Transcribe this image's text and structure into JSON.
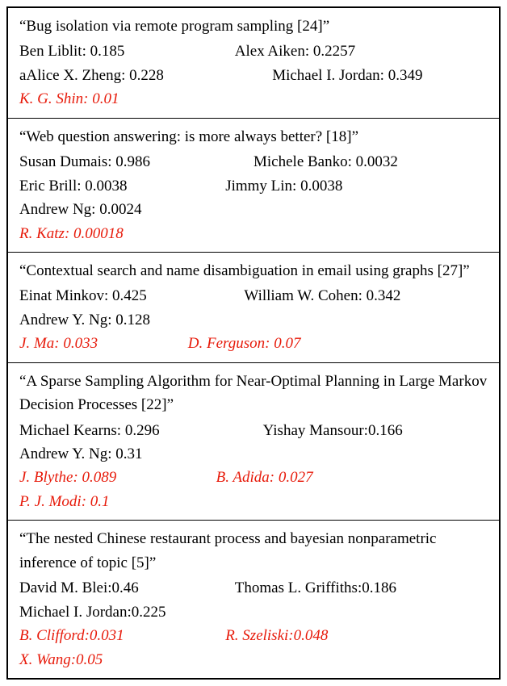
{
  "entries": [
    {
      "title": "“Bug isolation via remote program sampling [24]”",
      "authors": [
        [
          {
            "text": "Ben Liblit: 0.185"
          },
          {
            "text": "Alex Aiken: 0.2257"
          }
        ],
        [
          {
            "text": "aAlice X. Zheng: 0.228"
          },
          {
            "text": "Michael I. Jordan: 0.349"
          }
        ]
      ],
      "red": [
        [
          {
            "text": "K. G. Shin: 0.01"
          }
        ]
      ]
    },
    {
      "title": "“Web question answering: is more always better? [18]”",
      "authors": [
        [
          {
            "text": "Susan Dumais: 0.986"
          },
          {
            "text": "Michele Banko: 0.0032"
          }
        ],
        [
          {
            "text": "Eric Brill: 0.0038"
          },
          {
            "text": "Jimmy Lin: 0.0038"
          }
        ],
        [
          {
            "text": "Andrew Ng: 0.0024"
          }
        ]
      ],
      "red": [
        [
          {
            "text": "R. Katz: 0.00018"
          }
        ]
      ]
    },
    {
      "title": "“Contextual search and name disambiguation in email using graphs [27]”",
      "authors": [
        [
          {
            "text": "Einat Minkov: 0.425"
          },
          {
            "text": "William W. Cohen: 0.342"
          }
        ],
        [
          {
            "text": "Andrew Y. Ng: 0.128"
          }
        ]
      ],
      "red": [
        [
          {
            "text": "J. Ma: 0.033"
          },
          {
            "text": "D. Ferguson: 0.07"
          }
        ]
      ]
    },
    {
      "title": "“A Sparse Sampling Algorithm for Near-Optimal Planning in Large Markov Decision Processes [22]”",
      "authors": [
        [
          {
            "text": "Michael Kearns: 0.296"
          },
          {
            "text": "Yishay Mansour:0.166"
          }
        ],
        [
          {
            "text": "Andrew Y. Ng: 0.31"
          }
        ]
      ],
      "red": [
        [
          {
            "text": "J. Blythe: 0.089"
          },
          {
            "text": "B. Adida: 0.027"
          }
        ],
        [
          {
            "text": "P. J. Modi: 0.1"
          }
        ]
      ]
    },
    {
      "title": "“The nested Chinese restaurant process and bayesian nonparametric inference of topic [5]”",
      "authors": [
        [
          {
            "text": "David M. Blei:0.46"
          },
          {
            "text": "Thomas L. Griffiths:0.186"
          }
        ],
        [
          {
            "text": "Michael I. Jordan:0.225"
          }
        ]
      ],
      "red": [
        [
          {
            "text": "B. Clifford:0.031"
          },
          {
            "text": "R. Szeliski:0.048"
          }
        ],
        [
          {
            "text": "X. Wang:0.05"
          }
        ]
      ]
    }
  ],
  "chart_data": {
    "type": "table",
    "title": "Author score table per paper",
    "columns": [
      "paper_title",
      "author",
      "score",
      "highlighted_red"
    ],
    "rows": [
      {
        "paper_title": "Bug isolation via remote program sampling [24]",
        "author": "Ben Liblit",
        "score": 0.185,
        "highlighted_red": false
      },
      {
        "paper_title": "Bug isolation via remote program sampling [24]",
        "author": "Alex Aiken",
        "score": 0.2257,
        "highlighted_red": false
      },
      {
        "paper_title": "Bug isolation via remote program sampling [24]",
        "author": "aAlice X. Zheng",
        "score": 0.228,
        "highlighted_red": false
      },
      {
        "paper_title": "Bug isolation via remote program sampling [24]",
        "author": "Michael I. Jordan",
        "score": 0.349,
        "highlighted_red": false
      },
      {
        "paper_title": "Bug isolation via remote program sampling [24]",
        "author": "K. G. Shin",
        "score": 0.01,
        "highlighted_red": true
      },
      {
        "paper_title": "Web question answering: is more always better? [18]",
        "author": "Susan Dumais",
        "score": 0.986,
        "highlighted_red": false
      },
      {
        "paper_title": "Web question answering: is more always better? [18]",
        "author": "Michele Banko",
        "score": 0.0032,
        "highlighted_red": false
      },
      {
        "paper_title": "Web question answering: is more always better? [18]",
        "author": "Eric Brill",
        "score": 0.0038,
        "highlighted_red": false
      },
      {
        "paper_title": "Web question answering: is more always better? [18]",
        "author": "Jimmy Lin",
        "score": 0.0038,
        "highlighted_red": false
      },
      {
        "paper_title": "Web question answering: is more always better? [18]",
        "author": "Andrew Ng",
        "score": 0.0024,
        "highlighted_red": false
      },
      {
        "paper_title": "Web question answering: is more always better? [18]",
        "author": "R. Katz",
        "score": 0.00018,
        "highlighted_red": true
      },
      {
        "paper_title": "Contextual search and name disambiguation in email using graphs [27]",
        "author": "Einat Minkov",
        "score": 0.425,
        "highlighted_red": false
      },
      {
        "paper_title": "Contextual search and name disambiguation in email using graphs [27]",
        "author": "William W. Cohen",
        "score": 0.342,
        "highlighted_red": false
      },
      {
        "paper_title": "Contextual search and name disambiguation in email using graphs [27]",
        "author": "Andrew Y. Ng",
        "score": 0.128,
        "highlighted_red": false
      },
      {
        "paper_title": "Contextual search and name disambiguation in email using graphs [27]",
        "author": "J. Ma",
        "score": 0.033,
        "highlighted_red": true
      },
      {
        "paper_title": "Contextual search and name disambiguation in email using graphs [27]",
        "author": "D. Ferguson",
        "score": 0.07,
        "highlighted_red": true
      },
      {
        "paper_title": "A Sparse Sampling Algorithm for Near-Optimal Planning in Large Markov Decision Processes [22]",
        "author": "Michael Kearns",
        "score": 0.296,
        "highlighted_red": false
      },
      {
        "paper_title": "A Sparse Sampling Algorithm for Near-Optimal Planning in Large Markov Decision Processes [22]",
        "author": "Yishay Mansour",
        "score": 0.166,
        "highlighted_red": false
      },
      {
        "paper_title": "A Sparse Sampling Algorithm for Near-Optimal Planning in Large Markov Decision Processes [22]",
        "author": "Andrew Y. Ng",
        "score": 0.31,
        "highlighted_red": false
      },
      {
        "paper_title": "A Sparse Sampling Algorithm for Near-Optimal Planning in Large Markov Decision Processes [22]",
        "author": "J. Blythe",
        "score": 0.089,
        "highlighted_red": true
      },
      {
        "paper_title": "A Sparse Sampling Algorithm for Near-Optimal Planning in Large Markov Decision Processes [22]",
        "author": "B. Adida",
        "score": 0.027,
        "highlighted_red": true
      },
      {
        "paper_title": "A Sparse Sampling Algorithm for Near-Optimal Planning in Large Markov Decision Processes [22]",
        "author": "P. J. Modi",
        "score": 0.1,
        "highlighted_red": true
      },
      {
        "paper_title": "The nested Chinese restaurant process and bayesian nonparametric inference of topic [5]",
        "author": "David M. Blei",
        "score": 0.46,
        "highlighted_red": false
      },
      {
        "paper_title": "The nested Chinese restaurant process and bayesian nonparametric inference of topic [5]",
        "author": "Thomas L. Griffiths",
        "score": 0.186,
        "highlighted_red": false
      },
      {
        "paper_title": "The nested Chinese restaurant process and bayesian nonparametric inference of topic [5]",
        "author": "Michael I. Jordan",
        "score": 0.225,
        "highlighted_red": false
      },
      {
        "paper_title": "The nested Chinese restaurant process and bayesian nonparametric inference of topic [5]",
        "author": "B. Clifford",
        "score": 0.031,
        "highlighted_red": true
      },
      {
        "paper_title": "The nested Chinese restaurant process and bayesian nonparametric inference of topic [5]",
        "author": "R. Szeliski",
        "score": 0.048,
        "highlighted_red": true
      },
      {
        "paper_title": "The nested Chinese restaurant process and bayesian nonparametric inference of topic [5]",
        "author": "X. Wang",
        "score": 0.05,
        "highlighted_red": true
      }
    ]
  }
}
